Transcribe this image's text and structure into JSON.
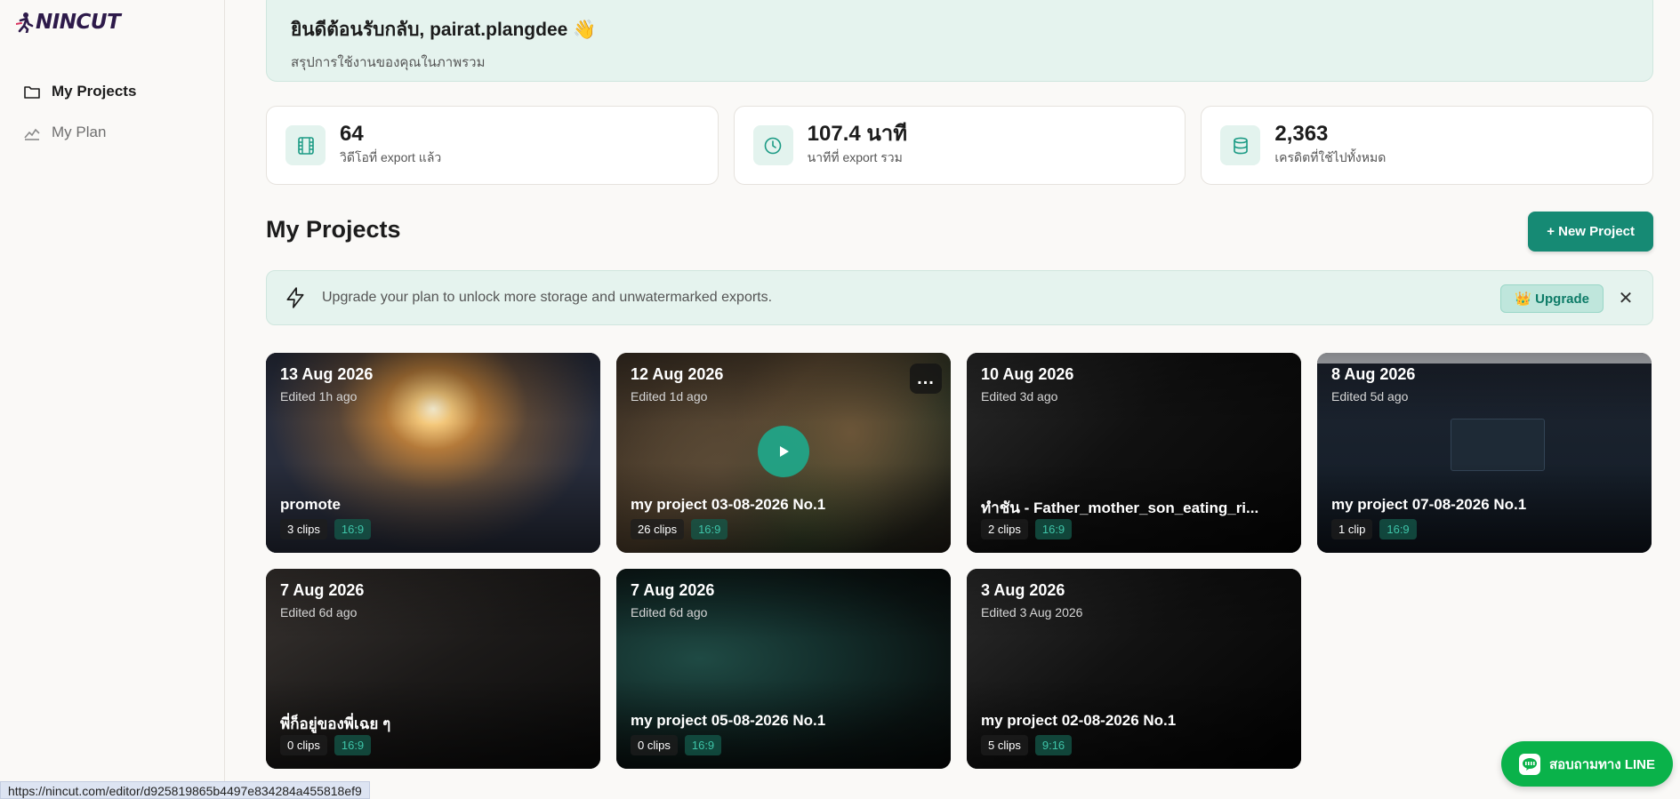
{
  "app": {
    "logo_text": "NINCUT"
  },
  "sidebar": {
    "items": [
      {
        "label": "My Projects",
        "icon": "folder-icon",
        "active": true
      },
      {
        "label": "My Plan",
        "icon": "chart-icon",
        "active": false
      }
    ]
  },
  "welcome": {
    "title": "ยินดีต้อนรับกลับ, pairat.plangdee 👋",
    "subtitle": "สรุปการใช้งานของคุณในภาพรวม"
  },
  "stats": [
    {
      "value": "64",
      "label": "วิดีโอที่ export แล้ว",
      "icon": "film-icon"
    },
    {
      "value": "107.4 นาที",
      "label": "นาทีที่ export รวม",
      "icon": "clock-icon"
    },
    {
      "value": "2,363",
      "label": "เครดิตที่ใช้ไปทั้งหมด",
      "icon": "database-icon"
    }
  ],
  "projects_section": {
    "title": "My Projects",
    "new_button": "+ New Project"
  },
  "banner": {
    "text": "Upgrade your plan to unlock more storage and unwatermarked exports.",
    "upgrade_label": "👑 Upgrade",
    "close_label": "✕"
  },
  "projects": [
    {
      "date": "13 Aug 2026",
      "edited": "Edited 1h ago",
      "name": "promote",
      "clips": "3 clips",
      "ratio": "16:9"
    },
    {
      "date": "12 Aug 2026",
      "edited": "Edited 1d ago",
      "name": "my project 03-08-2026 No.1",
      "clips": "26 clips",
      "ratio": "16:9"
    },
    {
      "date": "10 Aug 2026",
      "edited": "Edited 3d ago",
      "name": "ทำชัน - Father_mother_son_eating_ri...",
      "clips": "2 clips",
      "ratio": "16:9"
    },
    {
      "date": "8 Aug 2026",
      "edited": "Edited 5d ago",
      "name": "my project 07-08-2026 No.1",
      "clips": "1 clip",
      "ratio": "16:9"
    },
    {
      "date": "7 Aug 2026",
      "edited": "Edited 6d ago",
      "name": "พี่ก็อยู่ของพี่เฉย ๆ",
      "clips": "0 clips",
      "ratio": "16:9"
    },
    {
      "date": "7 Aug 2026",
      "edited": "Edited 6d ago",
      "name": "my project 05-08-2026 No.1",
      "clips": "0 clips",
      "ratio": "16:9"
    },
    {
      "date": "3 Aug 2026",
      "edited": "Edited 3 Aug 2026",
      "name": "my project 02-08-2026 No.1",
      "clips": "5 clips",
      "ratio": "9:16"
    }
  ],
  "card_menu_label": "...",
  "line_button": {
    "label": "สอบถามทาง LINE"
  },
  "status_bar": {
    "url": "https://nincut.com/editor/d925819865b4497e834284a455818ef9"
  },
  "colors": {
    "accent": "#168a74",
    "line_green": "#0ab24a",
    "banner_bg": "#e5f3ee"
  }
}
